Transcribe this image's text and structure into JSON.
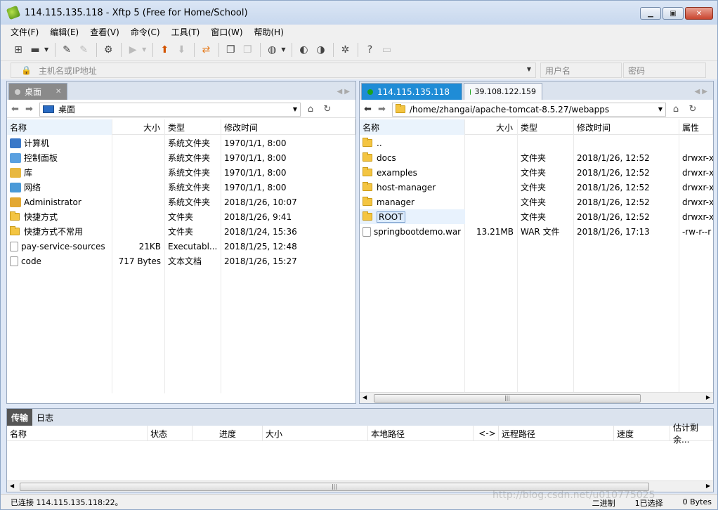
{
  "window": {
    "title": "114.115.135.118   - Xftp 5 (Free for Home/School)",
    "minimize": "▁",
    "maximize": "▣",
    "close": "✕"
  },
  "menu": [
    "文件(F)",
    "编辑(E)",
    "查看(V)",
    "命令(C)",
    "工具(T)",
    "窗口(W)",
    "帮助(H)"
  ],
  "address": {
    "placeholder": "主机名或IP地址",
    "user_placeholder": "用户名",
    "pass_placeholder": "密码"
  },
  "left_pane": {
    "tab_label": "桌面",
    "path": "桌面",
    "columns": [
      "名称",
      "大小",
      "类型",
      "修改时间"
    ],
    "rows": [
      {
        "name": "计算机",
        "size": "",
        "type": "系统文件夹",
        "modified": "1970/1/1, 8:00",
        "icon": "computer"
      },
      {
        "name": "控制面板",
        "size": "",
        "type": "系统文件夹",
        "modified": "1970/1/1, 8:00",
        "icon": "control-panel"
      },
      {
        "name": "库",
        "size": "",
        "type": "系统文件夹",
        "modified": "1970/1/1, 8:00",
        "icon": "library"
      },
      {
        "name": "网络",
        "size": "",
        "type": "系统文件夹",
        "modified": "1970/1/1, 8:00",
        "icon": "network"
      },
      {
        "name": "Administrator",
        "size": "",
        "type": "系统文件夹",
        "modified": "2018/1/26, 10:07",
        "icon": "user-folder"
      },
      {
        "name": "快捷方式",
        "size": "",
        "type": "文件夹",
        "modified": "2018/1/26, 9:41",
        "icon": "folder"
      },
      {
        "name": "快捷方式不常用",
        "size": "",
        "type": "文件夹",
        "modified": "2018/1/24, 15:36",
        "icon": "folder"
      },
      {
        "name": "pay-service-sources",
        "size": "21KB",
        "type": "Executabl...",
        "modified": "2018/1/25, 12:48",
        "icon": "file"
      },
      {
        "name": "code",
        "size": "717 Bytes",
        "type": "文本文档",
        "modified": "2018/1/26, 15:27",
        "icon": "file"
      }
    ]
  },
  "right_pane": {
    "tab_active": "114.115.135.118",
    "tab_other": "39.108.122.159",
    "path": "/home/zhangai/apache-tomcat-8.5.27/webapps",
    "columns": [
      "名称",
      "大小",
      "类型",
      "修改时间",
      "属性"
    ],
    "rows": [
      {
        "name": "..",
        "size": "",
        "type": "",
        "modified": "",
        "attr": "",
        "icon": "folder"
      },
      {
        "name": "docs",
        "size": "",
        "type": "文件夹",
        "modified": "2018/1/26, 12:52",
        "attr": "drwxr-x",
        "icon": "folder"
      },
      {
        "name": "examples",
        "size": "",
        "type": "文件夹",
        "modified": "2018/1/26, 12:52",
        "attr": "drwxr-x",
        "icon": "folder"
      },
      {
        "name": "host-manager",
        "size": "",
        "type": "文件夹",
        "modified": "2018/1/26, 12:52",
        "attr": "drwxr-x",
        "icon": "folder"
      },
      {
        "name": "manager",
        "size": "",
        "type": "文件夹",
        "modified": "2018/1/26, 12:52",
        "attr": "drwxr-x",
        "icon": "folder"
      },
      {
        "name": "ROOT",
        "size": "",
        "type": "文件夹",
        "modified": "2018/1/26, 12:52",
        "attr": "drwxr-x",
        "icon": "folder"
      },
      {
        "name": "springbootdemo.war",
        "size": "13.21MB",
        "type": "WAR 文件",
        "modified": "2018/1/26, 17:13",
        "attr": "-rw-r--r",
        "icon": "file"
      }
    ],
    "selected_row": "ROOT"
  },
  "transfer": {
    "tabs": [
      "传输",
      "日志"
    ],
    "columns": [
      "名称",
      "状态",
      "进度",
      "大小",
      "本地路径",
      "<->",
      "远程路径",
      "速度",
      "估计剩余..."
    ]
  },
  "status": {
    "left": "已连接 114.115.135.118:22。",
    "mode": "二进制",
    "selected": "1已选择",
    "bytes": "0 Bytes"
  },
  "watermark": "http://blog.csdn.net/u010775025",
  "colors": {
    "accent_blue": "#1f8cd6",
    "connected_green": "#1aa31a",
    "folder_yellow": "#f4c542"
  }
}
